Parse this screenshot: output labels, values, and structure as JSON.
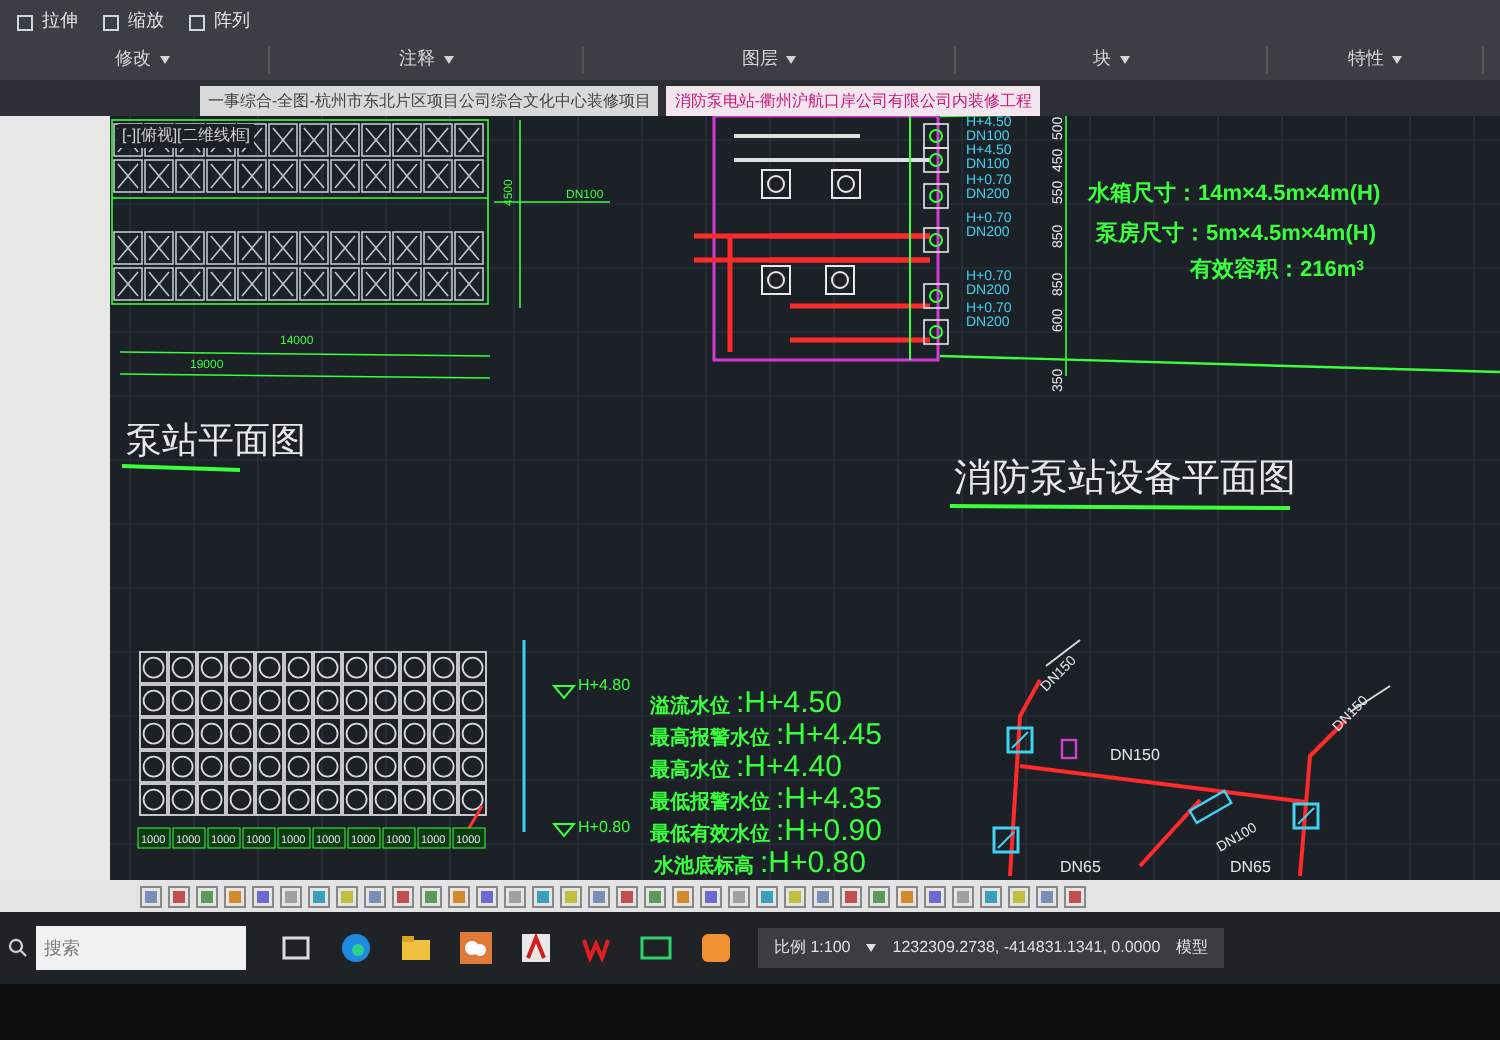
{
  "ribbon": {
    "tools": [
      "拉伸",
      "缩放",
      "阵列"
    ],
    "groups": [
      "修改",
      "注释",
      "图层",
      "块",
      "特性"
    ]
  },
  "tabs": [
    {
      "label": "一事综合-全图-杭州市东北片区项目公司综合文化中心装修项目",
      "selected": false
    },
    {
      "label": "消防泵电站-衢州沪航口岸公司有限公司内装修工程",
      "selected": true
    }
  ],
  "viewport": {
    "label": "[-][俯视][二维线框]"
  },
  "drawing": {
    "titles": [
      "泵站平面图",
      "消防泵站设备平面图"
    ],
    "plan_dimensions": [
      "14000",
      "19000",
      "4500"
    ],
    "vent_label": "DN100",
    "pipe_labels": [
      {
        "elevation": "H+4.50",
        "size": "DN100"
      },
      {
        "elevation": "H+4.50",
        "size": "DN100"
      },
      {
        "elevation": "H+0.70",
        "size": "DN200"
      },
      {
        "elevation": "H+0.70",
        "size": "DN200"
      },
      {
        "elevation": "H+0.70",
        "size": "DN200"
      },
      {
        "elevation": "H+0.70",
        "size": "DN200"
      }
    ],
    "room_dimensions": [
      "500",
      "450",
      "550",
      "850",
      "850",
      "600",
      "350"
    ],
    "tank_notes": [
      "水箱尺寸：14m×4.5m×4m(H)",
      "泵房尺寸：5m×4.5m×4m(H)",
      "有效容积：216m$^{3}$"
    ],
    "section_marks": [
      "H+4.80",
      "H+0.80"
    ],
    "water_levels": [
      {
        "name": "溢流水位",
        "elevation": ":H+4.50"
      },
      {
        "name": "最高报警水位",
        "elevation": ":H+4.45"
      },
      {
        "name": "最高水位",
        "elevation": ":H+4.40"
      },
      {
        "name": "最低报警水位",
        "elevation": ":H+4.35"
      },
      {
        "name": "最低有效水位",
        "elevation": ":H+0.90"
      },
      {
        "name": "水池底标高",
        "elevation": ":H+0.80"
      }
    ],
    "section_dimensions": [
      "1000",
      "1000",
      "1000",
      "1000",
      "1000",
      "1000",
      "1000",
      "1000",
      "1000",
      "1000"
    ],
    "system_pipes": [
      "DN150",
      "DN150",
      "DN150",
      "DN100",
      "DN65",
      "DN65"
    ]
  },
  "status_bar": {
    "scale": "比例 1:100",
    "coordinates": "1232309.2738, -414831.1341, 0.0000",
    "space": "模型"
  },
  "taskbar": {
    "search_placeholder": "搜索"
  }
}
